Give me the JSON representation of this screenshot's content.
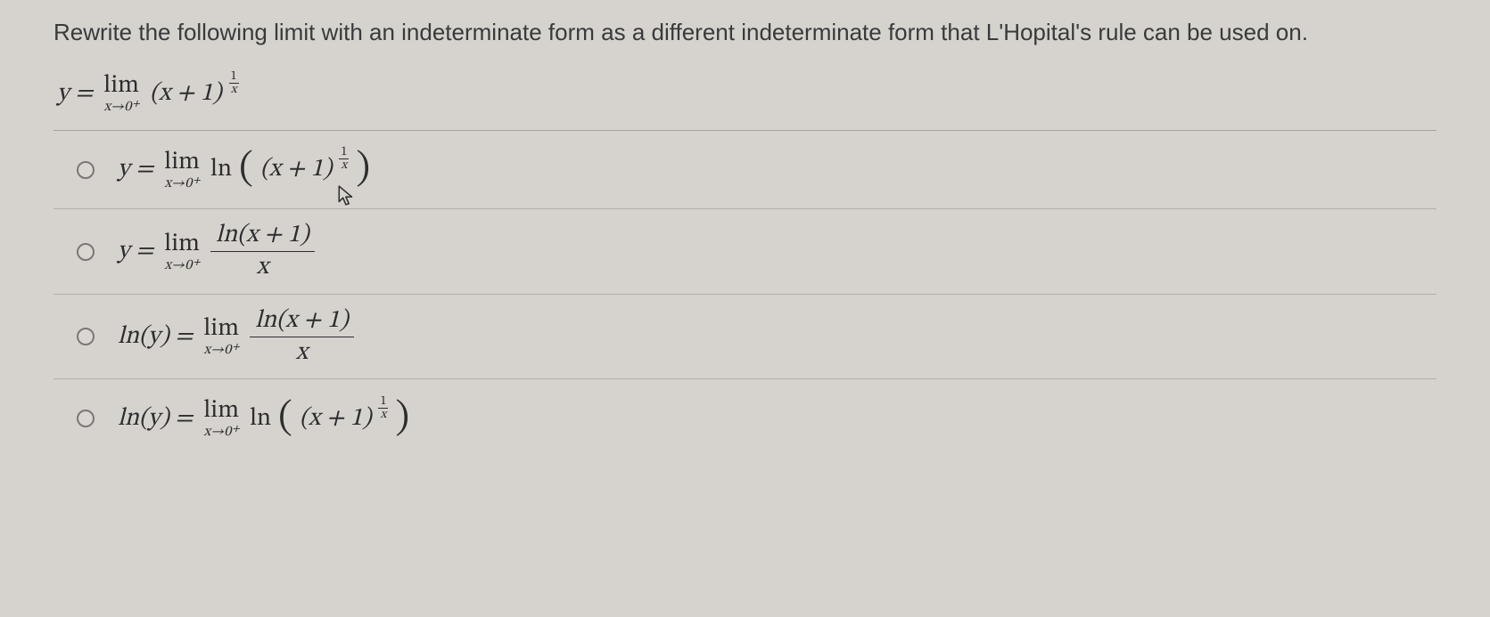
{
  "prompt": "Rewrite the following limit with an indeterminate form as a different indeterminate form that L'Hopital's rule can be used on.",
  "given": {
    "lhs": "y =",
    "lim_label": "lim",
    "lim_sub": "x→0⁺",
    "base": "(x + 1)",
    "exp_num": "1",
    "exp_den": "x"
  },
  "options": [
    {
      "lhs": "y =",
      "lim_label": "lim",
      "lim_sub": "x→0⁺",
      "ln": "ln",
      "inner_base": "(x + 1)",
      "exp_num": "1",
      "exp_den": "x",
      "layout": "ln_of_power"
    },
    {
      "lhs": "y =",
      "lim_label": "lim",
      "lim_sub": "x→0⁺",
      "frac_num": "ln(x + 1)",
      "frac_den": "x",
      "layout": "frac"
    },
    {
      "lhs": "ln(y) =",
      "lim_label": "lim",
      "lim_sub": "x→0⁺",
      "frac_num": "ln(x + 1)",
      "frac_den": "x",
      "layout": "frac"
    },
    {
      "lhs": "ln(y) =",
      "lim_label": "lim",
      "lim_sub": "x→0⁺",
      "ln": "ln",
      "inner_base": "(x + 1)",
      "exp_num": "1",
      "exp_den": "x",
      "layout": "ln_of_power"
    }
  ]
}
